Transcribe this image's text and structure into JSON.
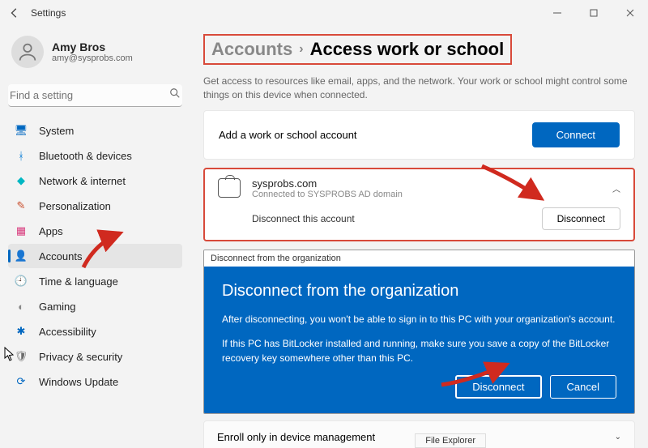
{
  "window": {
    "title": "Settings"
  },
  "user": {
    "name": "Amy Bros",
    "email": "amy@sysprobs.com"
  },
  "search": {
    "placeholder": "Find a setting"
  },
  "nav": [
    {
      "label": "System",
      "color": "#0067c0",
      "glyph": "🖥"
    },
    {
      "label": "Bluetooth & devices",
      "color": "#0078d4",
      "glyph": "ᚼ"
    },
    {
      "label": "Network & internet",
      "color": "#00b7c3",
      "glyph": "◆"
    },
    {
      "label": "Personalization",
      "color": "#c94f2e",
      "glyph": "✎"
    },
    {
      "label": "Apps",
      "color": "#d83b7d",
      "glyph": "▦"
    },
    {
      "label": "Accounts",
      "color": "#107c10",
      "glyph": "👤"
    },
    {
      "label": "Time & language",
      "color": "#915bb5",
      "glyph": "🕘"
    },
    {
      "label": "Gaming",
      "color": "#888888",
      "glyph": "◐"
    },
    {
      "label": "Accessibility",
      "color": "#0067c0",
      "glyph": "✱"
    },
    {
      "label": "Privacy & security",
      "color": "#6b6b6b",
      "glyph": "🛡"
    },
    {
      "label": "Windows Update",
      "color": "#0067c0",
      "glyph": "⟳"
    }
  ],
  "breadcrumb": {
    "parent": "Accounts",
    "current": "Access work or school"
  },
  "description": "Get access to resources like email, apps, and the network. Your work or school might control some things on this device when connected.",
  "addAccount": {
    "label": "Add a work or school account",
    "button": "Connect"
  },
  "connectedAccount": {
    "domain": "sysprobs.com",
    "status": "Connected to SYSPROBS AD domain",
    "disconnectLabel": "Disconnect this account",
    "disconnectButton": "Disconnect"
  },
  "dialog": {
    "titlebar": "Disconnect from the organization",
    "heading": "Disconnect from the organization",
    "body1": "After disconnecting, you won't be able to sign in to this PC with your organization's account.",
    "body2": "If this PC has BitLocker installed and running, make sure you save a copy of the BitLocker recovery key somewhere other than this PC.",
    "primary": "Disconnect",
    "secondary": "Cancel"
  },
  "enroll": {
    "label": "Enroll only in device management"
  },
  "taskbar": {
    "label": "File Explorer"
  }
}
